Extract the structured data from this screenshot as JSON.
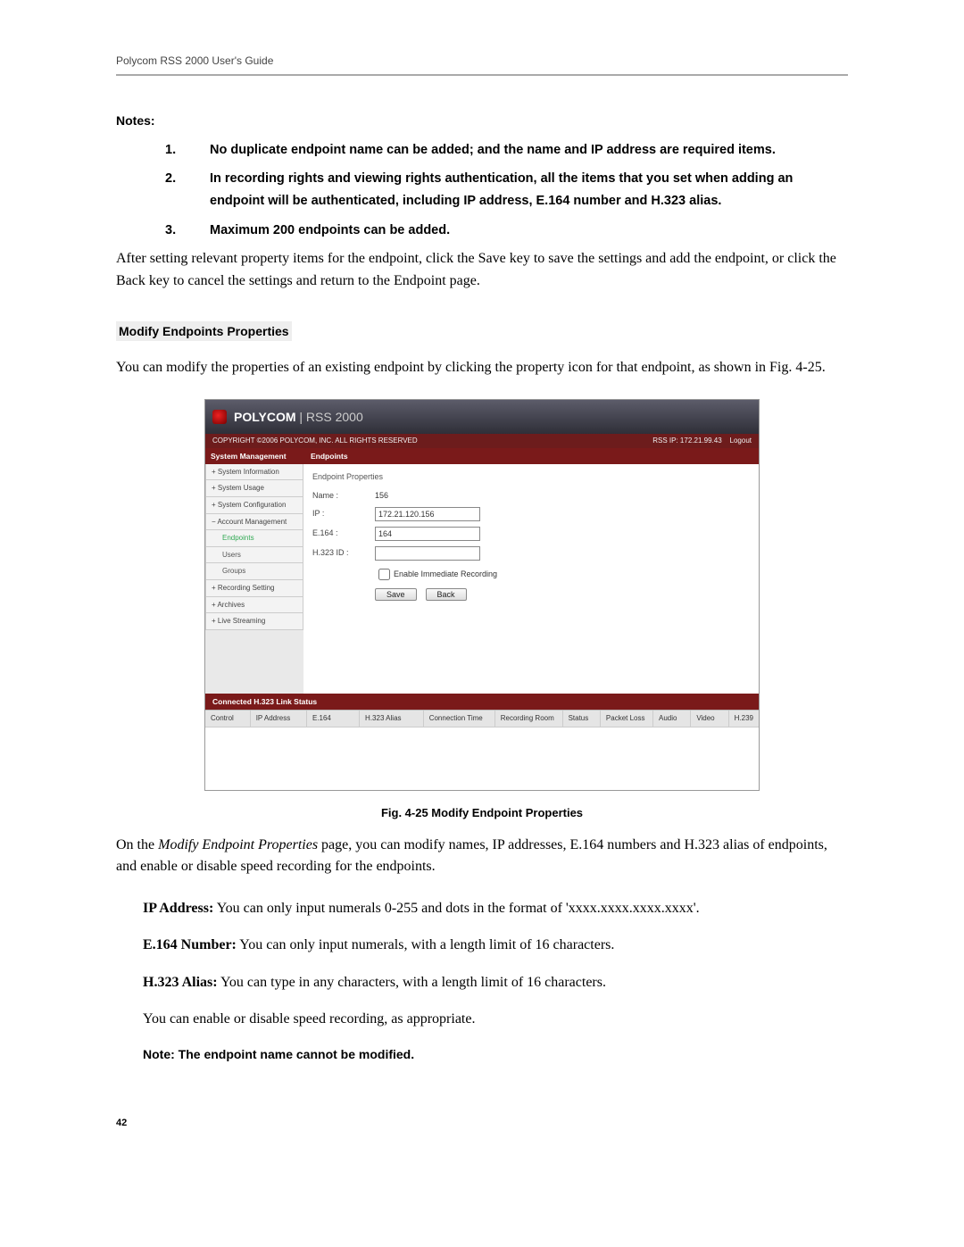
{
  "header": {
    "title": "Polycom RSS 2000 User's Guide"
  },
  "notes": {
    "label": "Notes:",
    "items": [
      "No duplicate endpoint name can be added; and the name and IP address are required items.",
      "In recording rights and viewing rights authentication, all the items that you set when adding an endpoint will be authenticated, including IP address, E.164 number and H.323 alias.",
      "Maximum 200 endpoints can be added."
    ]
  },
  "para_after_notes": "After setting relevant property items for the endpoint, click the Save key to save the settings and add the endpoint, or click the Back key to cancel the settings and return to the Endpoint page.",
  "section": {
    "heading": "Modify Endpoints Properties",
    "intro": "You can modify the properties of an existing endpoint by clicking the property icon for that endpoint, as shown in Fig. 4-25."
  },
  "figure": {
    "brand_main": "POLYCOM",
    "brand_sub": "RSS 2000",
    "copyright": "COPYRIGHT ©2006 POLYCOM, INC. ALL RIGHTS RESERVED",
    "rss_ip_label": "RSS IP: 172.21.99.43",
    "logout": "Logout",
    "nav_heading": "System Management",
    "nav_items": [
      "System Information",
      "System Usage",
      "System Configuration",
      "Account Management"
    ],
    "nav_sub_selected": "Endpoints",
    "nav_sub_items": [
      "Users",
      "Groups"
    ],
    "nav_items2": [
      "Recording Setting",
      "Archives",
      "Live Streaming"
    ],
    "main_heading": "Endpoints",
    "panel_title": "Endpoint Properties",
    "field_name_label": "Name :",
    "field_name_value": "156",
    "field_ip_label": "IP :",
    "field_ip_value": "172.21.120.156",
    "field_e164_label": "E.164 :",
    "field_e164_value": "164",
    "field_h323_label": "H.323 ID :",
    "field_h323_value": "",
    "checkbox_label": "Enable Immediate Recording",
    "save_label": "Save",
    "back_label": "Back",
    "link_status_heading": "Connected H.323 Link Status",
    "cols": [
      "Control",
      "IP Address",
      "E.164",
      "H.323 Alias",
      "Connection Time",
      "Recording Room",
      "Status",
      "Packet Loss",
      "Audio",
      "Video",
      "H.239"
    ],
    "caption": "Fig. 4-25 Modify Endpoint Properties"
  },
  "after_figure": {
    "p1_a": "On the ",
    "p1_ital": "Modify Endpoint Properties",
    "p1_b": " page, you can modify names, IP addresses, E.164 numbers and H.323 alias of endpoints, and enable or disable speed recording for the endpoints.",
    "bullets": [
      {
        "lead": "IP Address:",
        "text": " You can only input numerals 0-255 and dots in the format of 'xxxx.xxxx.xxxx.xxxx'."
      },
      {
        "lead": "E.164 Number:",
        "text": " You can only input numerals, with a length limit of 16 characters."
      },
      {
        "lead": "H.323 Alias:",
        "text": " You can type in any characters, with a length limit of 16 characters."
      }
    ],
    "p_last": "You can enable or disable speed recording, as appropriate.",
    "note": "Note: The endpoint name cannot be modified."
  },
  "page_number": "42"
}
